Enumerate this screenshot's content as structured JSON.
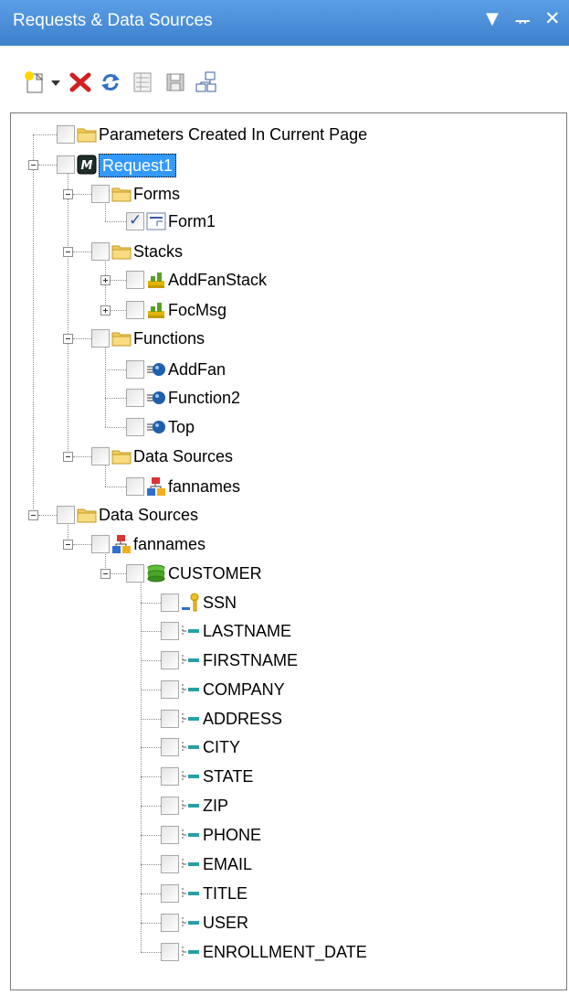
{
  "window": {
    "title": "Requests & Data Sources",
    "controls": {
      "dropdown_icon": "triangle-down",
      "pin_icon": "pin",
      "close_icon": "x"
    }
  },
  "toolbar": {
    "buttons": [
      {
        "name": "new",
        "icon": "new-document"
      },
      {
        "name": "dropdown",
        "icon": "triangle-down"
      },
      {
        "name": "delete",
        "icon": "red-x"
      },
      {
        "name": "refresh",
        "icon": "refresh-arrows"
      },
      {
        "name": "properties",
        "icon": "grid-list"
      },
      {
        "name": "save",
        "icon": "save-disk"
      },
      {
        "name": "organize",
        "icon": "hierarchy"
      }
    ]
  },
  "tree": {
    "nodes": [
      {
        "label": "Parameters Created In Current Page",
        "icon": "folder",
        "checked": false
      },
      {
        "label": "Request1",
        "icon": "request-m",
        "checked": false,
        "selected": true
      },
      {
        "label": "Forms",
        "icon": "folder",
        "checked": false
      },
      {
        "label": "Form1",
        "icon": "form",
        "checked": true
      },
      {
        "label": "Stacks",
        "icon": "folder",
        "checked": false
      },
      {
        "label": "AddFanStack",
        "icon": "stack",
        "checked": false
      },
      {
        "label": "FocMsg",
        "icon": "stack",
        "checked": false
      },
      {
        "label": "Functions",
        "icon": "folder",
        "checked": false
      },
      {
        "label": "AddFan",
        "icon": "function",
        "checked": false
      },
      {
        "label": "Function2",
        "icon": "function",
        "checked": false
      },
      {
        "label": "Top",
        "icon": "function",
        "checked": false
      },
      {
        "label": "Data Sources",
        "icon": "folder",
        "checked": false
      },
      {
        "label": "fannames",
        "icon": "datasource",
        "checked": false
      },
      {
        "label": "Data Sources",
        "icon": "folder",
        "checked": false
      },
      {
        "label": "fannames",
        "icon": "datasource",
        "checked": false
      },
      {
        "label": "CUSTOMER",
        "icon": "segment",
        "checked": false
      },
      {
        "label": "SSN",
        "icon": "key",
        "checked": false
      },
      {
        "label": "LASTNAME",
        "icon": "field",
        "checked": false
      },
      {
        "label": "FIRSTNAME",
        "icon": "field",
        "checked": false
      },
      {
        "label": "COMPANY",
        "icon": "field",
        "checked": false
      },
      {
        "label": "ADDRESS",
        "icon": "field",
        "checked": false
      },
      {
        "label": "CITY",
        "icon": "field",
        "checked": false
      },
      {
        "label": "STATE",
        "icon": "field",
        "checked": false
      },
      {
        "label": "ZIP",
        "icon": "field",
        "checked": false
      },
      {
        "label": "PHONE",
        "icon": "field",
        "checked": false
      },
      {
        "label": "EMAIL",
        "icon": "field",
        "checked": false
      },
      {
        "label": "TITLE",
        "icon": "field",
        "checked": false
      },
      {
        "label": "USER",
        "icon": "field",
        "checked": false
      },
      {
        "label": "ENROLLMENT_DATE",
        "icon": "field",
        "checked": false
      }
    ]
  }
}
